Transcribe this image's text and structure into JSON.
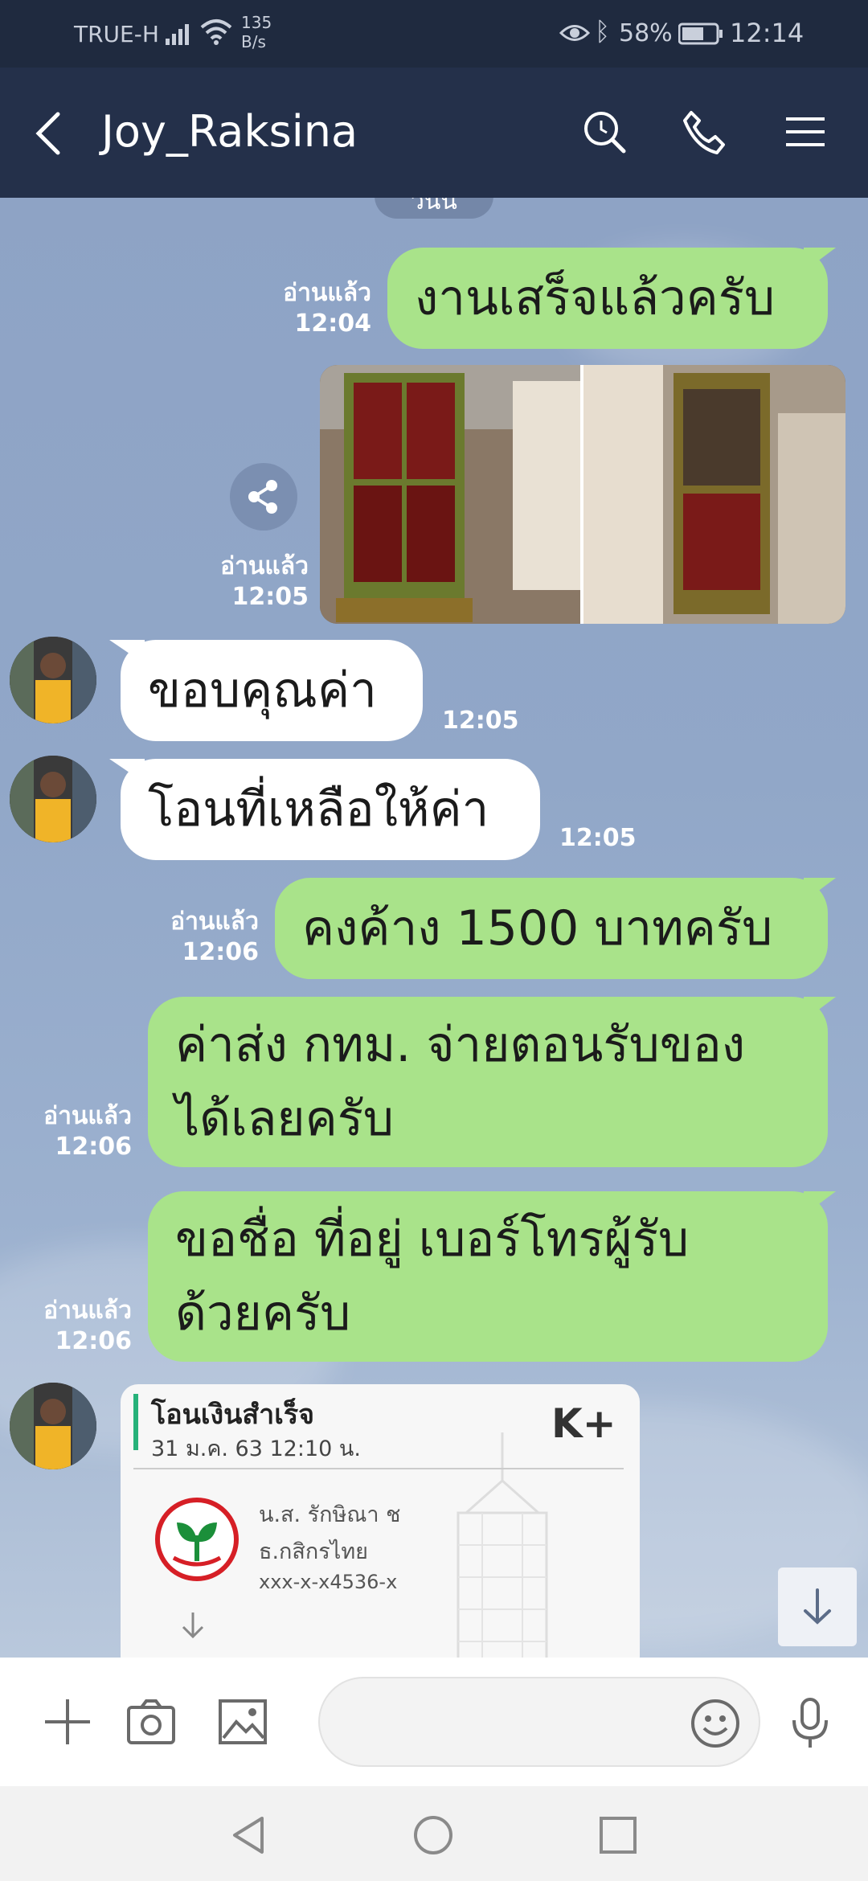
{
  "status_bar": {
    "carrier": "TRUE-H",
    "net_speed_value": "135",
    "net_speed_unit": "B/s",
    "battery_percent": "58%",
    "time": "12:14",
    "icons": [
      "signal-icon",
      "wifi-icon",
      "eye-icon",
      "bluetooth-icon",
      "battery-icon"
    ]
  },
  "header": {
    "contact_name": "Joy_Raksina",
    "icons": [
      "back-arrow-icon",
      "search-icon",
      "phone-icon",
      "menu-icon"
    ]
  },
  "chat": {
    "date_pill": "วันนี้",
    "messages": [
      {
        "direction": "out",
        "text": "งานเสร็จแล้วครับ",
        "read_label": "อ่านแล้ว",
        "time": "12:04"
      },
      {
        "direction": "out",
        "type": "photo",
        "read_label": "อ่านแล้ว",
        "time": "12:05"
      },
      {
        "direction": "in",
        "text": "ขอบคุณค่า",
        "time": "12:05"
      },
      {
        "direction": "in",
        "text": "โอนที่เหลือให้ค่า",
        "time": "12:05"
      },
      {
        "direction": "out",
        "text": "คงค้าง 1500 บาทครับ",
        "read_label": "อ่านแล้ว",
        "time": "12:06"
      },
      {
        "direction": "out",
        "lines": [
          "ค่าส่ง กทม. จ่ายตอนรับของ",
          "ได้เลยครับ"
        ],
        "read_label": "อ่านแล้ว",
        "time": "12:06"
      },
      {
        "direction": "out",
        "lines": [
          "ขอชื่อ ที่อยู่ เบอร์โทรผู้รับ",
          "ด้วยครับ"
        ],
        "read_label": "อ่านแล้ว",
        "time": "12:06"
      }
    ],
    "transfer_slip": {
      "title": "โอนเงินสำเร็จ",
      "datetime": "31 ม.ค. 63  12:10 น.",
      "brand": "K+",
      "recipient_name": "น.ส. รักษิณา ช",
      "bank": "ธ.กสิกรไทย",
      "account": "xxx-x-x4536-x"
    }
  },
  "input_bar": {
    "message_value": "",
    "icons": [
      "plus-icon",
      "camera-icon",
      "image-icon",
      "emoji-icon",
      "microphone-icon"
    ]
  },
  "nav_bar": {
    "icons": [
      "back-triangle-icon",
      "home-circle-icon",
      "recents-square-icon"
    ]
  },
  "colors": {
    "header_bg": "#24304a",
    "status_bg": "#1f2a3f",
    "outgoing_bubble": "#a9e38a",
    "incoming_bubble": "#ffffff",
    "chat_bg": "#8fa4c4"
  }
}
